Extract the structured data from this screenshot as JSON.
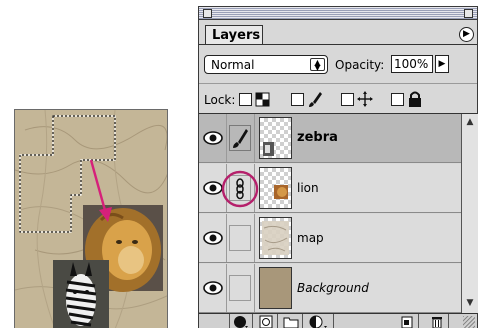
{
  "palette": {
    "tab_label": "Layers",
    "menu_icon": "palette-menu-arrow-icon"
  },
  "blend_mode": {
    "selected": "Normal"
  },
  "opacity": {
    "label": "Opacity:",
    "value": "100%"
  },
  "lock": {
    "label": "Lock:"
  },
  "layers": [
    {
      "name": "zebra",
      "selected": true,
      "link_icon": "brush-icon"
    },
    {
      "name": "lion",
      "selected": false,
      "link_icon": "link-chain-icon"
    },
    {
      "name": "map",
      "selected": false,
      "link_icon": ""
    },
    {
      "name": "Background",
      "selected": false,
      "link_icon": ""
    }
  ],
  "colors": {
    "highlight_circle": "#b5206b",
    "arrow": "#d6207a",
    "selected_row": "#b8b8b8"
  },
  "bottom_buttons": [
    "layer-style-icon",
    "add-mask-icon",
    "new-set-icon",
    "adjustment-layer-icon",
    "new-layer-icon",
    "trash-icon"
  ]
}
